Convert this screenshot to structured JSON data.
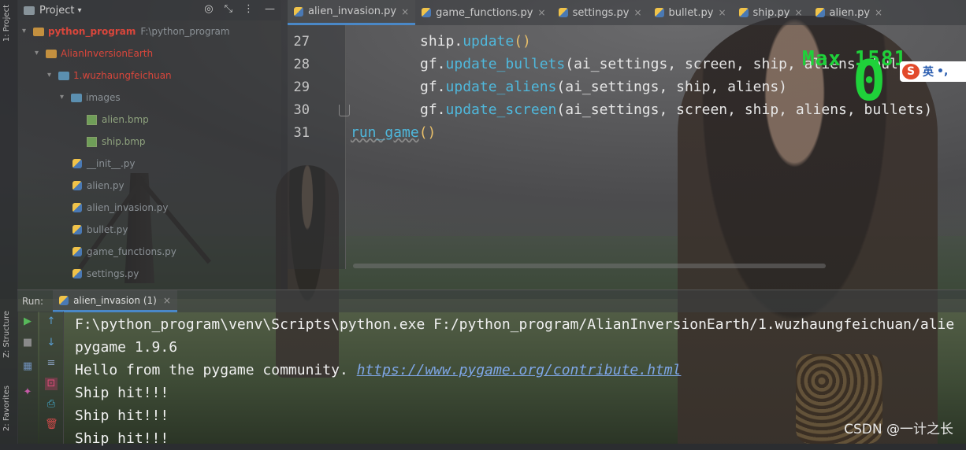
{
  "project_panel": {
    "title": "Project",
    "tree": [
      {
        "label": "python_program",
        "suffix": "F:\\python_program"
      },
      {
        "label": "AlianInversionEarth"
      },
      {
        "label": "1.wuzhaungfeichuan"
      },
      {
        "label": "images"
      },
      {
        "label": "alien.bmp"
      },
      {
        "label": "ship.bmp"
      },
      {
        "label": "__init__.py"
      },
      {
        "label": "alien.py"
      },
      {
        "label": "alien_invasion.py"
      },
      {
        "label": "bullet.py"
      },
      {
        "label": "game_functions.py"
      },
      {
        "label": "settings.py"
      }
    ]
  },
  "side_tabs": {
    "project": "1: Project",
    "structure": "Z: Structure",
    "favorites": "2: Favorites"
  },
  "editor": {
    "tabs": [
      {
        "label": "alien_invasion.py",
        "active": true
      },
      {
        "label": "game_functions.py"
      },
      {
        "label": "settings.py"
      },
      {
        "label": "bullet.py"
      },
      {
        "label": "ship.py"
      },
      {
        "label": "alien.py"
      }
    ],
    "line_numbers": [
      "27",
      "28",
      "29",
      "30",
      "31"
    ],
    "lines": {
      "l27_obj": "ship.",
      "l27_fn": "update",
      "l27_rest": "()",
      "l28_obj": "gf.",
      "l28_fn": "update_bullets",
      "l28_args": "(ai_settings, screen, ship, aliens, bul",
      "l29_obj": "gf.",
      "l29_fn": "update_aliens",
      "l29_args": "(ai_settings, ship, aliens)",
      "l30_obj": "gf.",
      "l30_fn": "update_screen",
      "l30_args": "(ai_settings, screen, ship, aliens, bullets)",
      "l31_fn": "run_game",
      "l31_rest": "()"
    }
  },
  "game_overlay": {
    "max_label": "Max 1581",
    "score": "0"
  },
  "ime": {
    "logo": "S",
    "lang": "英",
    "punc": "•,"
  },
  "run_panel": {
    "label": "Run:",
    "tab": "alien_invasion (1)",
    "output": {
      "cmd": "F:\\python_program\\venv\\Scripts\\python.exe F:/python_program/AlianInversionEarth/1.wuzhaungfeichuan/alie",
      "version": "pygame 1.9.6",
      "hello": "Hello from the pygame community. ",
      "link": "https://www.pygame.org/contribute.html",
      "hit1": "Ship hit!!!",
      "hit2": "Ship hit!!!",
      "hit3": "Ship hit!!!"
    }
  },
  "watermark": "CSDN @一计之长"
}
